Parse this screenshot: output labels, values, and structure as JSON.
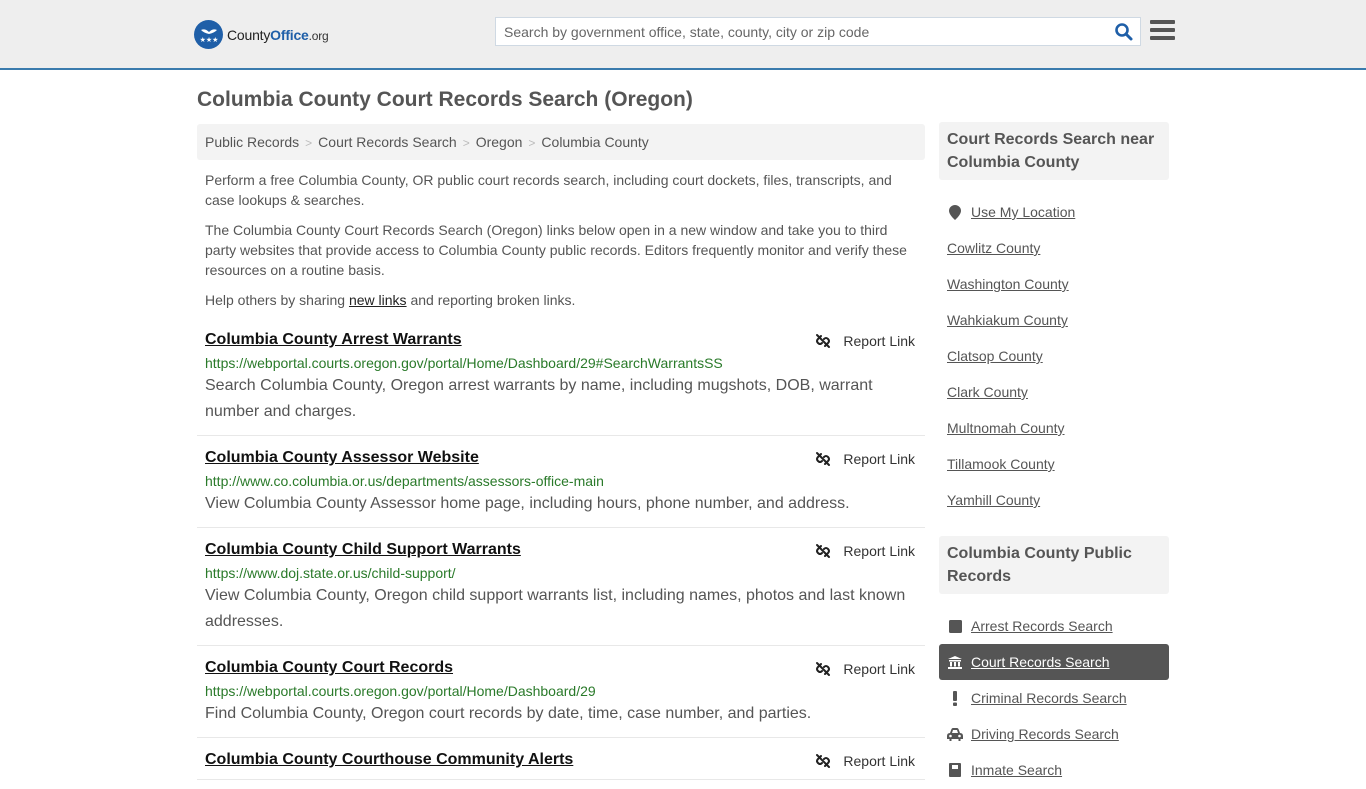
{
  "header": {
    "logo": {
      "county": "County",
      "office": "Office",
      "tld": ".org"
    },
    "search_placeholder": "Search by government office, state, county, city or zip code",
    "colors": {
      "brand_blue": "#1f5fa8",
      "topbar_border": "#3a7bad",
      "url_green": "#2a7a2a"
    }
  },
  "page": {
    "title": "Columbia County Court Records Search (Oregon)",
    "breadcrumb": [
      "Public Records",
      "Court Records Search",
      "Oregon",
      "Columbia County"
    ],
    "intro": {
      "p1": "Perform a free Columbia County, OR public court records search, including court dockets, files, transcripts, and case lookups & searches.",
      "p2": "The Columbia County Court Records Search (Oregon) links below open in a new window and take you to third party websites that provide access to Columbia County public records. Editors frequently monitor and verify these resources on a routine basis.",
      "p3_before": "Help others by sharing ",
      "p3_link": "new links",
      "p3_after": " and reporting broken links."
    }
  },
  "listings": [
    {
      "title": "Columbia County Arrest Warrants",
      "url": "https://webportal.courts.oregon.gov/portal/Home/Dashboard/29#SearchWarrantsSS",
      "desc": "Search Columbia County, Oregon arrest warrants by name, including mugshots, DOB, warrant number and charges.",
      "report": "Report Link"
    },
    {
      "title": "Columbia County Assessor Website",
      "url": "http://www.co.columbia.or.us/departments/assessors-office-main",
      "desc": "View Columbia County Assessor home page, including hours, phone number, and address.",
      "report": "Report Link"
    },
    {
      "title": "Columbia County Child Support Warrants",
      "url": "https://www.doj.state.or.us/child-support/",
      "desc": "View Columbia County, Oregon child support warrants list, including names, photos and last known addresses.",
      "report": "Report Link"
    },
    {
      "title": "Columbia County Court Records",
      "url": "https://webportal.courts.oregon.gov/portal/Home/Dashboard/29",
      "desc": "Find Columbia County, Oregon court records by date, time, case number, and parties.",
      "report": "Report Link"
    },
    {
      "title": "Columbia County Courthouse Community Alerts",
      "url": "",
      "desc": "",
      "report": "Report Link"
    }
  ],
  "sidebar": {
    "nearby": {
      "heading": "Court Records Search near Columbia County",
      "use_location": "Use My Location",
      "counties": [
        "Cowlitz County",
        "Washington County",
        "Wahkiakum County",
        "Clatsop County",
        "Clark County",
        "Multnomah County",
        "Tillamook County",
        "Yamhill County"
      ]
    },
    "public_records": {
      "heading": "Columbia County Public Records",
      "items": [
        {
          "label": "Arrest Records Search",
          "icon": "square-icon",
          "active": false
        },
        {
          "label": "Court Records Search",
          "icon": "courthouse-icon",
          "active": true
        },
        {
          "label": "Criminal Records Search",
          "icon": "exclamation-icon",
          "active": false
        },
        {
          "label": "Driving Records Search",
          "icon": "car-icon",
          "active": false
        },
        {
          "label": "Inmate Search",
          "icon": "inmate-icon",
          "active": false
        }
      ]
    }
  }
}
